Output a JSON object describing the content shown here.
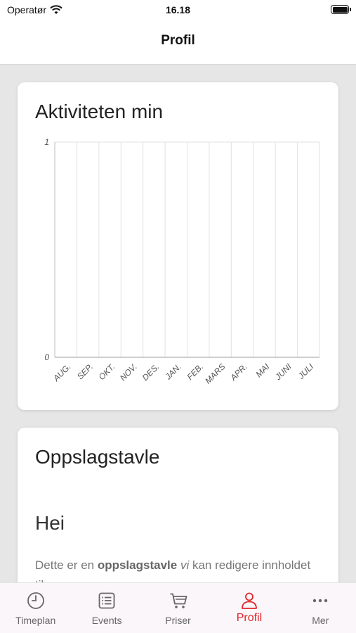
{
  "status_bar": {
    "carrier": "Operatør",
    "time": "16.18"
  },
  "header": {
    "title": "Profil"
  },
  "activity": {
    "title": "Aktiviteten min"
  },
  "chart_data": {
    "type": "bar",
    "categories": [
      "AUG.",
      "SEP.",
      "OKT.",
      "NOV.",
      "DES.",
      "JAN.",
      "FEB.",
      "MARS",
      "APR.",
      "MAI",
      "JUNI",
      "JULI"
    ],
    "values": [
      0,
      0,
      0,
      0,
      0,
      0,
      0,
      0,
      0,
      0,
      0,
      0
    ],
    "ylim": [
      0,
      1
    ],
    "yticks": [
      "0",
      "1"
    ],
    "grid": true
  },
  "board": {
    "title": "Oppslagstavle",
    "heading": "Hei",
    "text_intro": "Dette er en ",
    "text_bold": "oppslagstavle",
    "text_italic": "vi",
    "text_rest": " kan redigere inn­holdet til."
  },
  "tabs": [
    {
      "label": "Timeplan",
      "icon": "clock-icon",
      "active": false
    },
    {
      "label": "Events",
      "icon": "list-icon",
      "active": false
    },
    {
      "label": "Priser",
      "icon": "cart-icon",
      "active": false
    },
    {
      "label": "Profil",
      "icon": "person-icon",
      "active": true
    },
    {
      "label": "Mer",
      "icon": "more-icon",
      "active": false
    }
  ],
  "colors": {
    "accent": "#e0262b"
  }
}
